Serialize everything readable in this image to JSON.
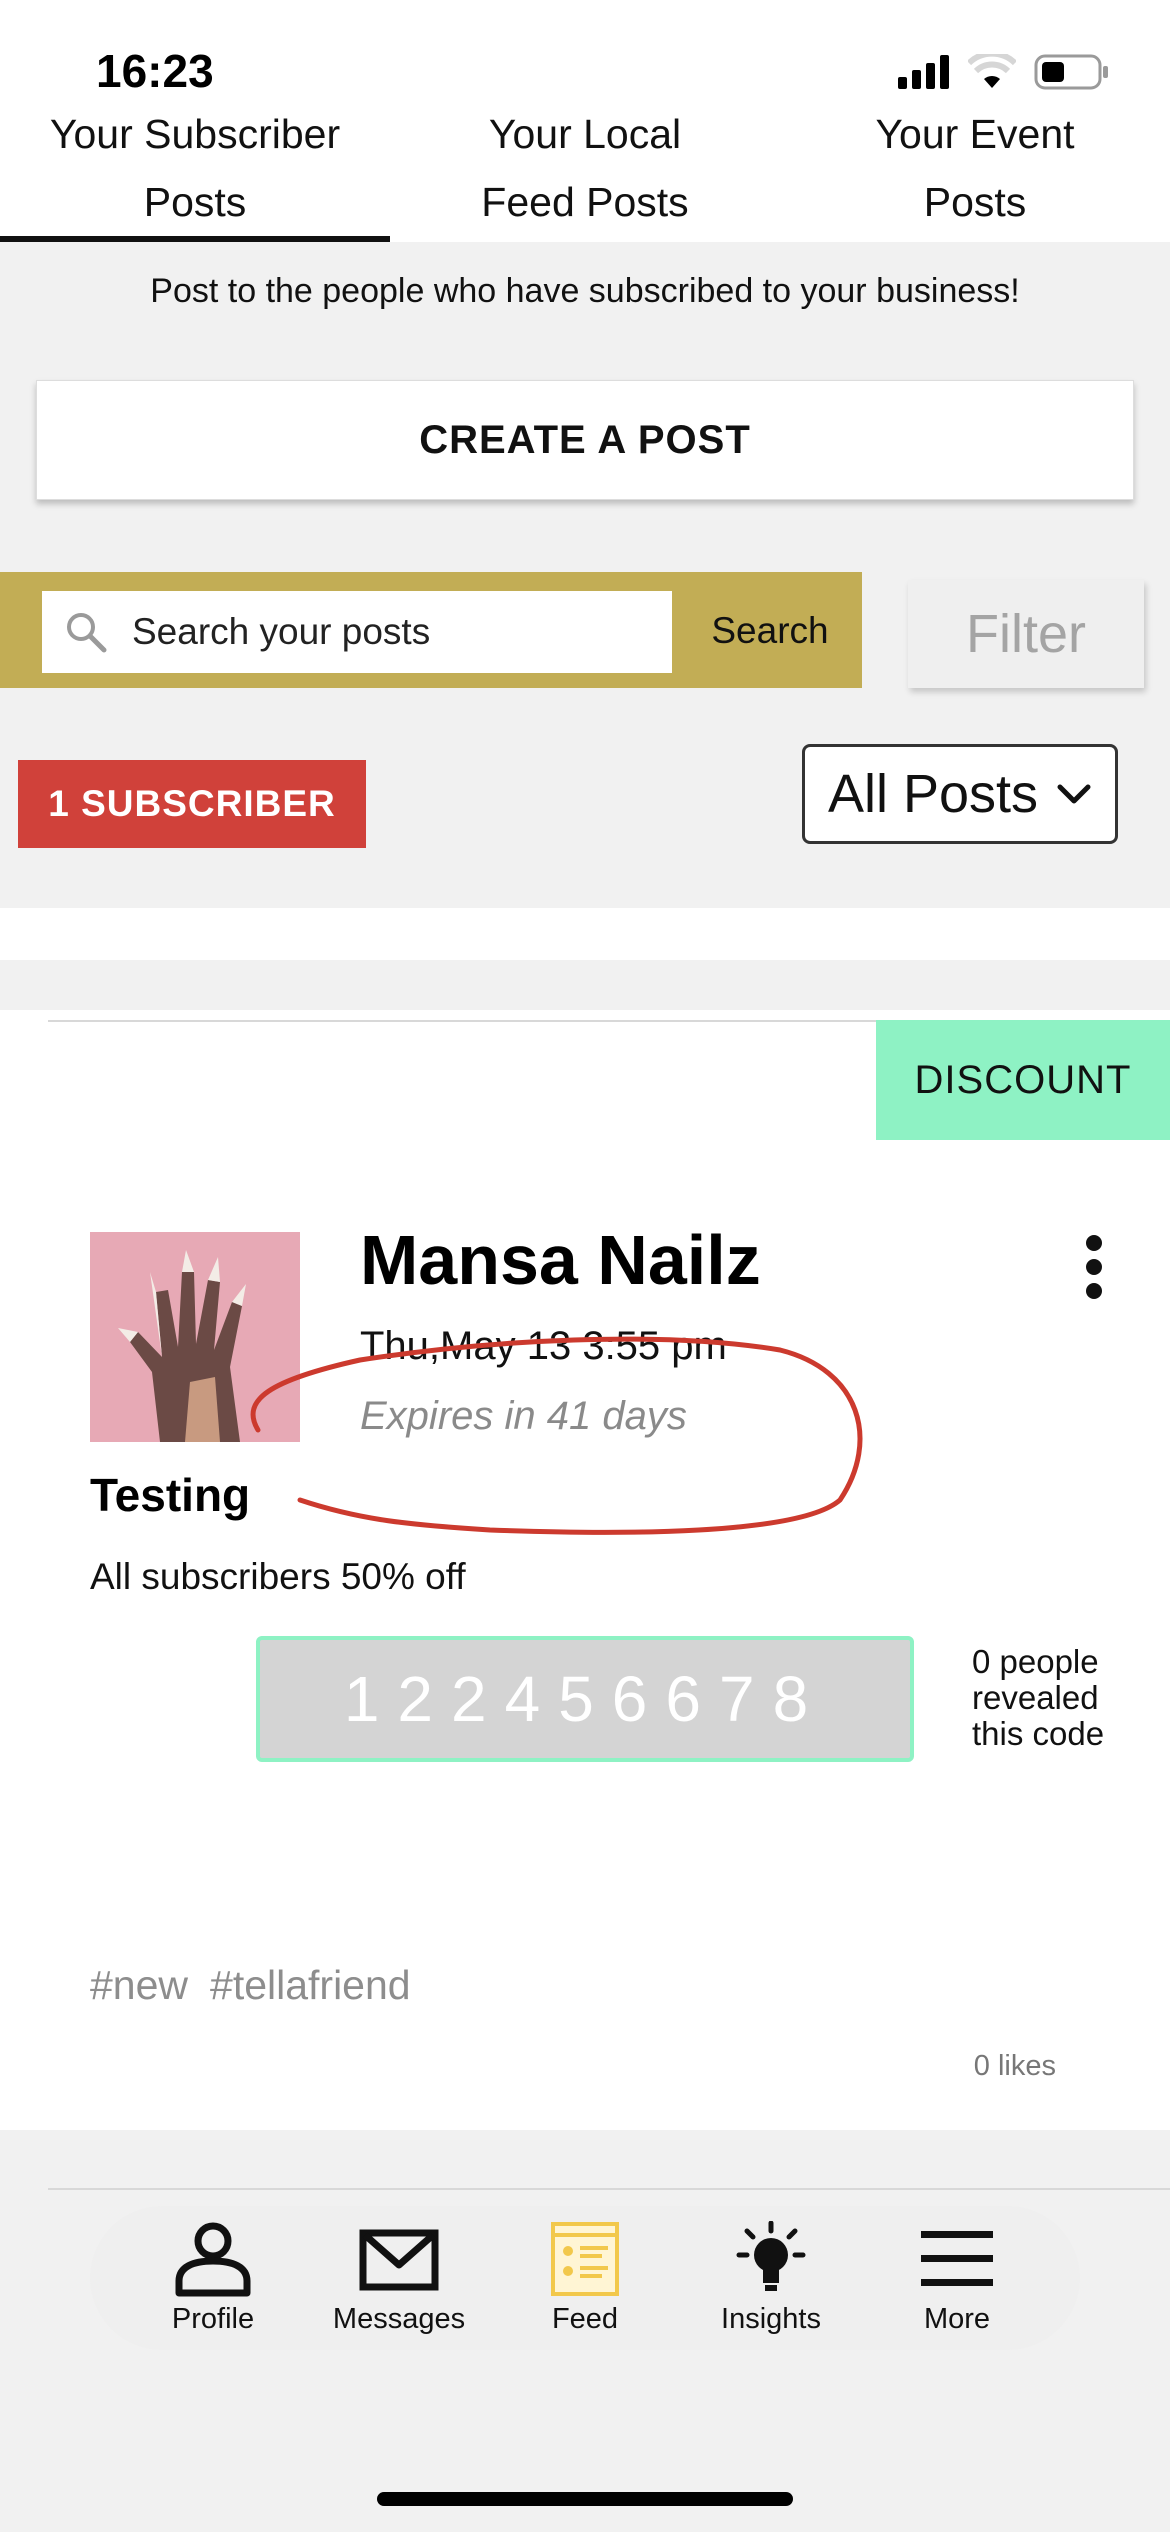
{
  "status_bar": {
    "time": "16:23"
  },
  "tabs": [
    {
      "line1": "Your Subscriber",
      "line2": "Posts",
      "active": true
    },
    {
      "line1": "Your Local",
      "line2": "Feed Posts",
      "active": false
    },
    {
      "line1": "Your Event",
      "line2": "Posts",
      "active": false
    }
  ],
  "intro_text": "Post to the people who have subscribed to your business!",
  "create_post_label": "CREATE A POST",
  "search": {
    "placeholder": "Search your posts",
    "button_label": "Search",
    "filter_label": "Filter"
  },
  "subscriber_badge": "1 SUBSCRIBER",
  "post_filter": {
    "selected": "All Posts"
  },
  "post": {
    "tag": "DISCOUNT",
    "business_name": "Mansa Nailz",
    "date": "Thu,May 13 3:55 pm",
    "expires": "Expires in 41 days",
    "title": "Testing",
    "body": "All subscribers 50% off",
    "code": "122456678",
    "revealed_text": "0 people revealed this code",
    "hashtags": [
      "#new",
      "#tellafriend"
    ],
    "likes": "0 likes"
  },
  "bottom_nav": [
    {
      "label": "Profile",
      "icon": "person-icon"
    },
    {
      "label": "Messages",
      "icon": "envelope-icon"
    },
    {
      "label": "Feed",
      "icon": "feed-icon"
    },
    {
      "label": "Insights",
      "icon": "lightbulb-icon"
    },
    {
      "label": "More",
      "icon": "menu-icon"
    }
  ],
  "colors": {
    "accent_gold": "#c2ad55",
    "badge_red": "#d0413a",
    "discount_green": "#8ef2c4",
    "feed_active": "#f2c84b"
  }
}
